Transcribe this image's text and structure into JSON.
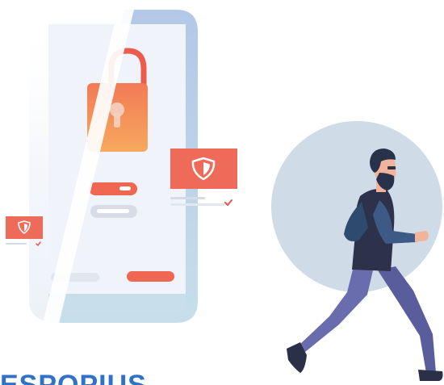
{
  "illustration": {
    "name": "mobile-security-illustration",
    "colors": {
      "phone_body": "#f0f2f9",
      "phone_frame_blue": "#b8c9e6",
      "phone_frame_light": "#c7dceb",
      "lock_orange_top": "#f28357",
      "lock_orange_bottom": "#f7a45c",
      "shackle_red": "#ec5c4e",
      "badge_red": "#ee6b59",
      "check_red": "#e8574a",
      "pill_red": "#ef6653",
      "circle_bg": "#cfdbe6",
      "pants_blue": "#6a6dad",
      "shirt_navy": "#2d3149",
      "skin": "#f2b39c",
      "hair": "#28324a",
      "shoe": "#2a3048"
    },
    "icons": [
      "phone-icon",
      "padlock-icon",
      "shield-icon",
      "checkmark-icon",
      "walking-man-figure"
    ]
  },
  "bottom_caption": {
    "text": "ESPOPIUS"
  }
}
